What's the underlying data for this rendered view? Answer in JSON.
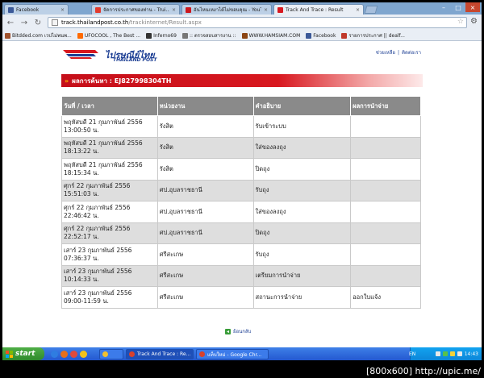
{
  "browser": {
    "tabs": [
      {
        "label": "Facebook",
        "color": "#3b5998",
        "active": false
      },
      {
        "label": "จัดการประกาศของท่าน - Trui...",
        "color": "#e23b2e",
        "active": false
      },
      {
        "label": "อันไหนเหงาได้ไม่ขอบคุณ - YouT...",
        "color": "#cc181e",
        "active": false
      },
      {
        "label": "Track And Trace : Result",
        "color": "#d71921",
        "active": true
      }
    ],
    "url_host": "track.thailandpost.co.th",
    "url_path": "/trackinternet/Result.aspx",
    "bookmarks": [
      {
        "label": "Bitdded.com เวปไม่พนพ...",
        "color": "#a0522d"
      },
      {
        "label": "UFOCOOL , The Best ...",
        "color": "#ff6a00"
      },
      {
        "label": "Inferno69",
        "color": "#333333"
      },
      {
        "label": ":: ตรวจสอบสารงาน ::",
        "color": "#777777"
      },
      {
        "label": "WWW.HAMSIAM.COM",
        "color": "#8b4513"
      },
      {
        "label": "Facebook",
        "color": "#3b5998"
      },
      {
        "label": "รายการประกาศ || dealf...",
        "color": "#c0392b"
      }
    ]
  },
  "site": {
    "brand_thai": "ไปรษณีย์ไทย",
    "brand_en": "THAILAND POST",
    "top_links": [
      "ช่วยเหลือ",
      "|",
      "ติดต่อเรา"
    ],
    "result_label": "ผลการค้นหา : EJ827998304TH",
    "columns": [
      "วันที่ / เวลา",
      "หน่วยงาน",
      "คำอธิบาย",
      "ผลการนำจ่าย"
    ],
    "rows": [
      {
        "date": "พฤหัสบดี 21 กุมภาพันธ์ 2556",
        "time": "13:00:50 น.",
        "office": "รังสิต",
        "desc": "รับเข้าระบบ",
        "result": ""
      },
      {
        "date": "พฤหัสบดี 21 กุมภาพันธ์ 2556",
        "time": "18:13:22 น.",
        "office": "รังสิต",
        "desc": "ใส่ของลงถุง",
        "result": ""
      },
      {
        "date": "พฤหัสบดี 21 กุมภาพันธ์ 2556",
        "time": "18:15:34 น.",
        "office": "รังสิต",
        "desc": "ปิดถุง",
        "result": ""
      },
      {
        "date": "ศุกร์ 22 กุมภาพันธ์ 2556",
        "time": "15:51:03 น.",
        "office": "ศป.อุบลราชธานี",
        "desc": "รับถุง",
        "result": ""
      },
      {
        "date": "ศุกร์ 22 กุมภาพันธ์ 2556",
        "time": "22:46:42 น.",
        "office": "ศป.อุบลราชธานี",
        "desc": "ใส่ของลงถุง",
        "result": ""
      },
      {
        "date": "ศุกร์ 22 กุมภาพันธ์ 2556",
        "time": "22:52:17 น.",
        "office": "ศป.อุบลราชธานี",
        "desc": "ปิดถุง",
        "result": ""
      },
      {
        "date": "เสาร์ 23 กุมภาพันธ์ 2556",
        "time": "07:36:37 น.",
        "office": "ศรีสะเกษ",
        "desc": "รับถุง",
        "result": ""
      },
      {
        "date": "เสาร์ 23 กุมภาพันธ์ 2556",
        "time": "10:14:33 น.",
        "office": "ศรีสะเกษ",
        "desc": "เตรียมการนำจ่าย",
        "result": ""
      },
      {
        "date": "เสาร์ 23 กุมภาพันธ์ 2556",
        "time": "09:00-11:59 น.",
        "office": "ศรีสะเกษ",
        "desc": "สถานะการนำจ่าย",
        "result": "ออกใบแจ้ง"
      }
    ],
    "back_label": "ย้อนกลับ"
  },
  "taskbar": {
    "start_label": "start",
    "tasks": [
      {
        "label": "",
        "color": "#f2c12e"
      },
      {
        "label": "Track And Trace : Re...",
        "color": "#d9412c"
      },
      {
        "label": "แท็บใหม่ - Google Chr...",
        "color": "#d9412c"
      }
    ],
    "language": "EN",
    "clock": "14:43"
  },
  "watermark": "[800x600] http://upic.me/",
  "colors": {
    "brand_blue": "#1d3f94",
    "brand_red": "#d8181f",
    "header_gray": "#8a8a8a",
    "row_alt": "#dedede"
  }
}
